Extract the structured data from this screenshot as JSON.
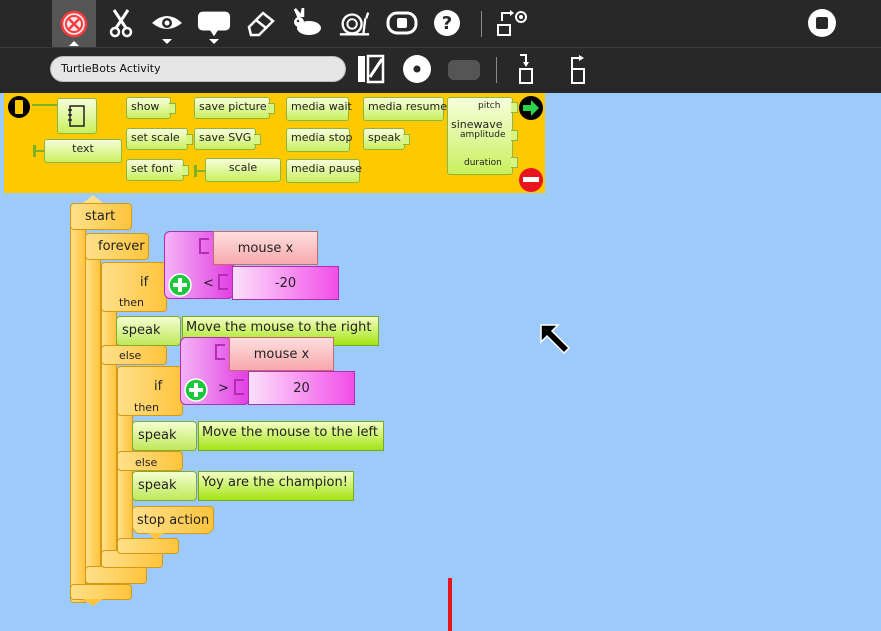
{
  "toolbar": {
    "activity_title": "TurtleBots Activity",
    "icons": [
      "activity-icon",
      "cut-icon",
      "eye-icon",
      "speech-icon",
      "eraser-icon",
      "rabbit-icon",
      "snail-icon",
      "debug-icon",
      "help-icon",
      "export-turtle-icon",
      "stop-icon"
    ]
  },
  "palette": {
    "blocks": {
      "show": "show",
      "set_scale": "set scale",
      "set_font": "set font",
      "save_picture": "save picture",
      "save_svg": "save SVG",
      "scale": "scale",
      "text": "text",
      "media_wait": "media wait",
      "media_stop": "media stop",
      "media_pause": "media pause",
      "media_resume": "media resume",
      "speak": "speak",
      "sinewave": "sinewave",
      "pitch": "pitch",
      "amplitude": "amplitude",
      "duration": "duration"
    }
  },
  "program": {
    "start": "start",
    "forever": "forever",
    "if1": "if",
    "then1": "then",
    "else1": "else",
    "mouse_x1": "mouse x",
    "lt": "<",
    "num1": "-20",
    "speak1": "speak",
    "speak1_text": "Move the mouse to the right",
    "if2": "if",
    "then2": "then",
    "else2": "else",
    "mouse_x2": "mouse x",
    "gt": ">",
    "num2": "20",
    "speak2": "speak",
    "speak2_text": "Move the mouse to the left",
    "speak3": "speak",
    "speak3_text": "Yoy are the champion!",
    "stop_action": "stop action"
  },
  "colors": {
    "toolbar": "#282828",
    "canvas": "#9ccbfb",
    "palette": "#ffc900",
    "pen": "#e8141e"
  }
}
